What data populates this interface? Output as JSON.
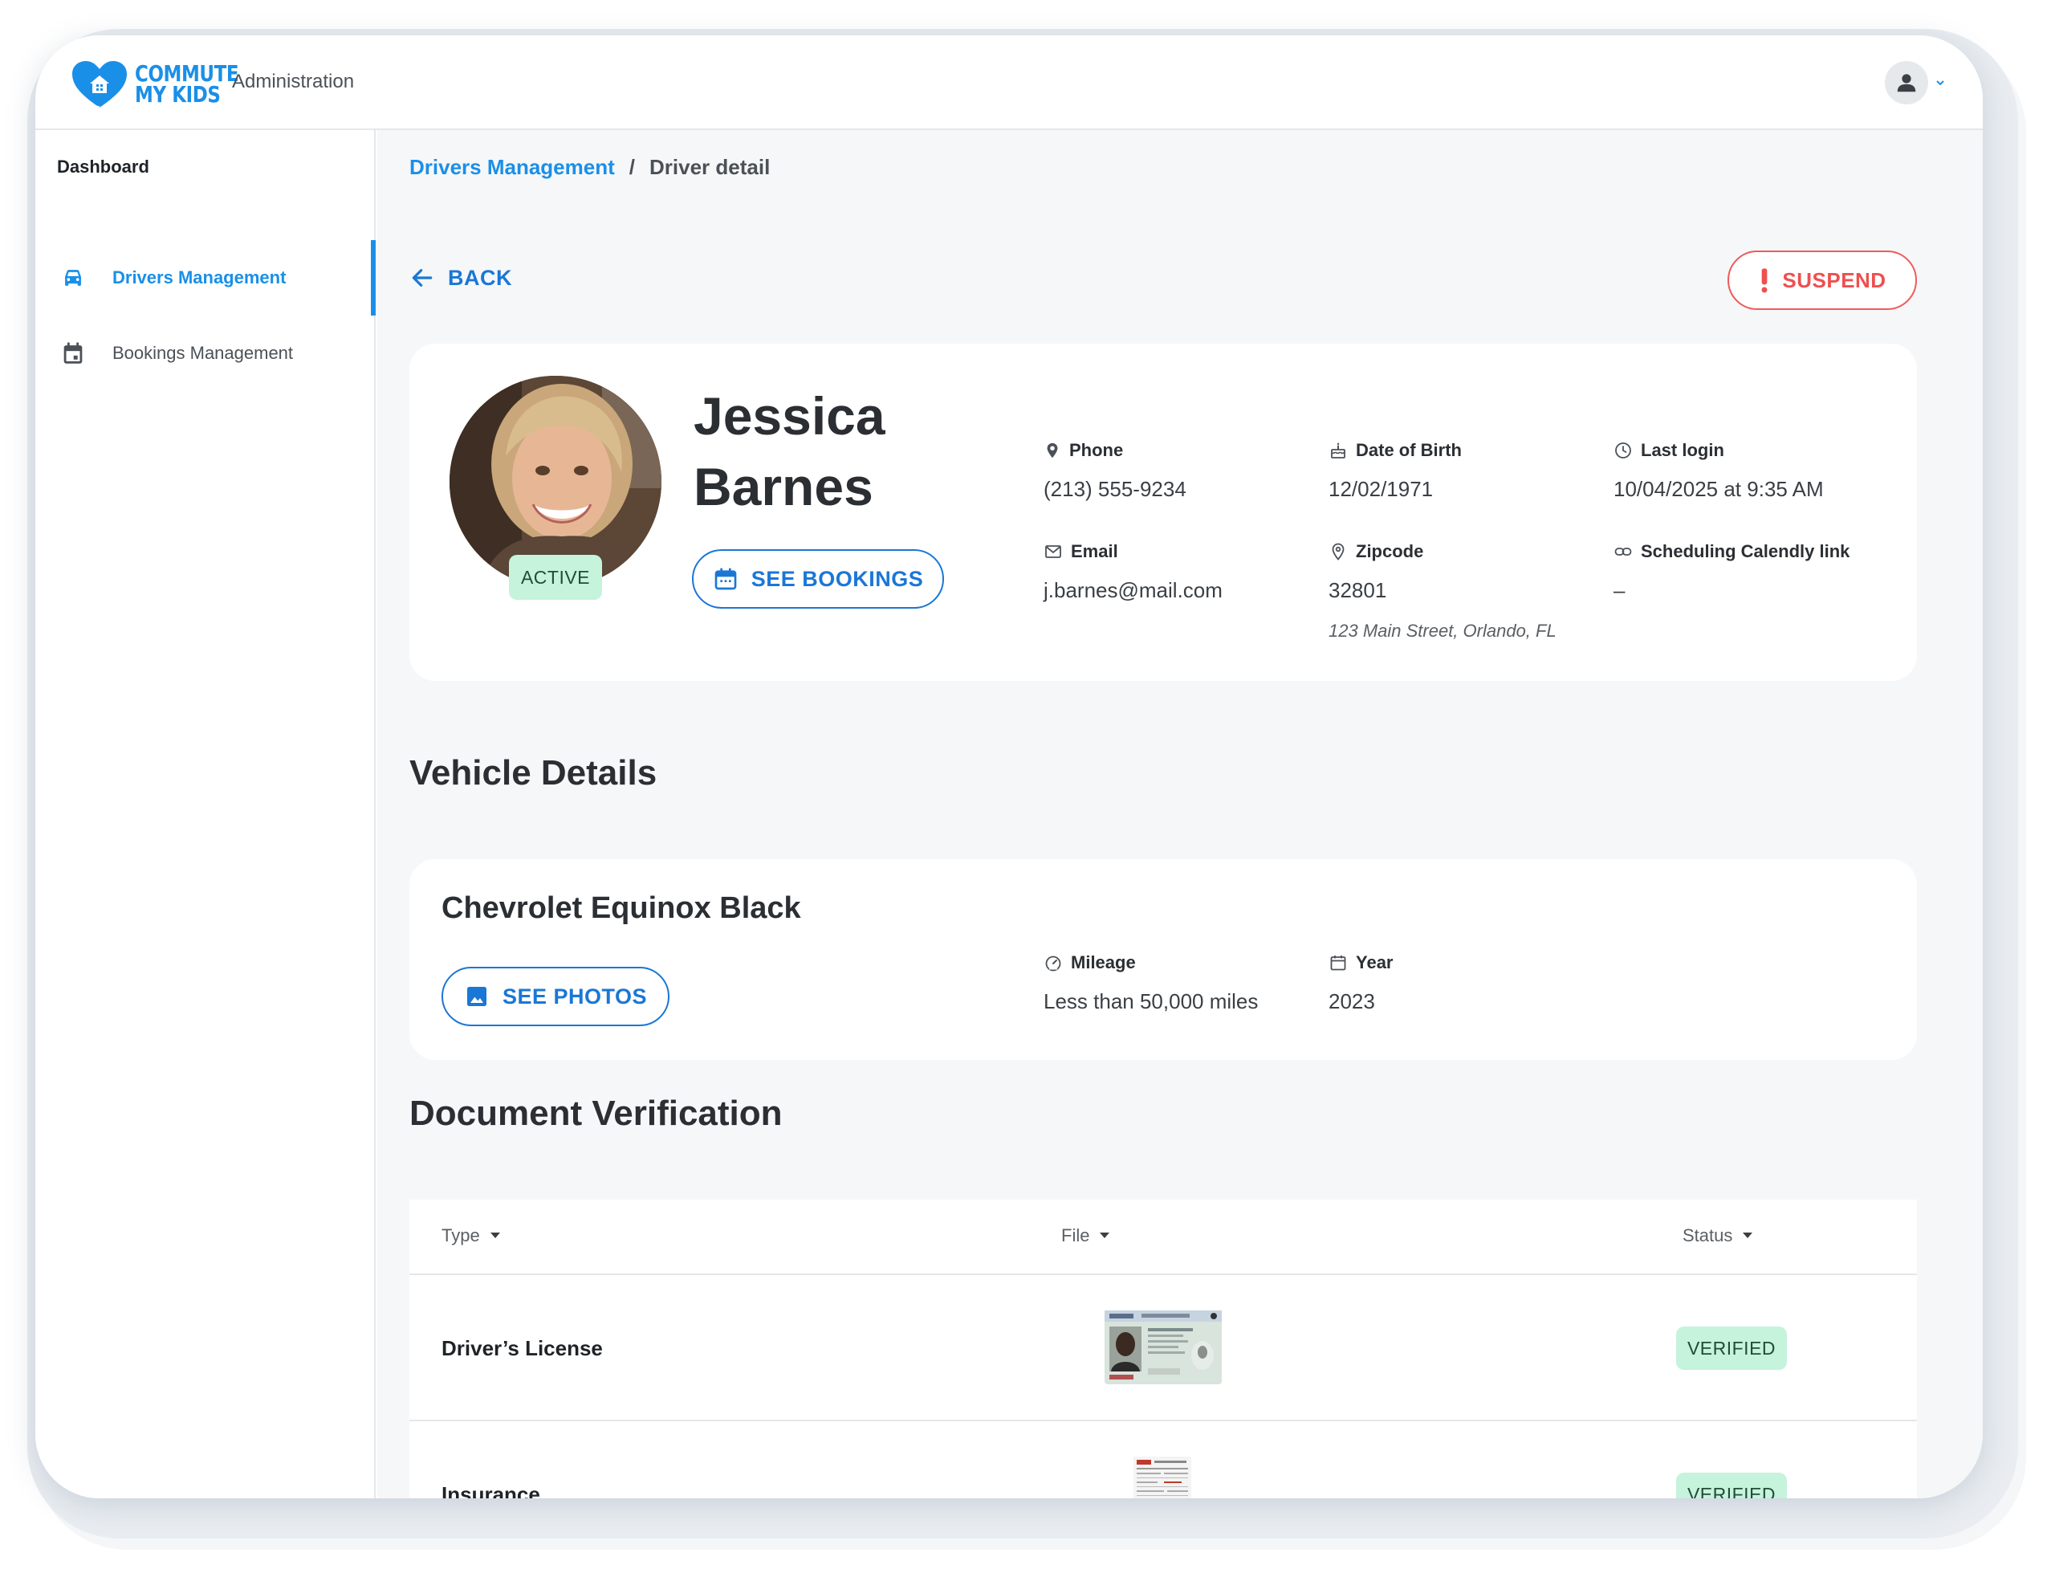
{
  "app": {
    "logo_line1": "COMMUTE",
    "logo_line2": "MY KIDS",
    "header_title": "Administration",
    "brand_color": "#1a8fe8"
  },
  "sidebar": {
    "title": "Dashboard",
    "items": [
      {
        "label": "Drivers Management",
        "icon": "car-icon",
        "active": true
      },
      {
        "label": "Bookings Management",
        "icon": "calendar-icon",
        "active": false
      }
    ]
  },
  "breadcrumb": {
    "parent": "Drivers Management",
    "separator": "/",
    "current": "Driver detail"
  },
  "actions": {
    "back_label": "BACK",
    "suspend_label": "SUSPEND"
  },
  "driver": {
    "first_name": "Jessica",
    "last_name": "Barnes",
    "status": "ACTIVE",
    "see_bookings_label": "SEE BOOKINGS",
    "fields": {
      "phone": {
        "label": "Phone",
        "value": "(213) 555-9234",
        "icon": "phone-pin-icon"
      },
      "dob": {
        "label": "Date of Birth",
        "value": "12/02/1971",
        "icon": "cake-icon"
      },
      "last_login": {
        "label": "Last login",
        "value": "10/04/2025 at 9:35 AM",
        "icon": "clock-icon"
      },
      "email": {
        "label": "Email",
        "value": "j.barnes@mail.com",
        "icon": "mail-icon"
      },
      "zipcode": {
        "label": "Zipcode",
        "value": "32801",
        "address": "123 Main Street, Orlando, FL",
        "icon": "location-pin-icon"
      },
      "calendly": {
        "label": "Scheduling Calendly link",
        "value": "–",
        "icon": "link-icon"
      }
    }
  },
  "vehicle": {
    "section_title": "Vehicle Details",
    "name": "Chevrolet Equinox Black",
    "see_photos_label": "SEE PHOTOS",
    "mileage": {
      "label": "Mileage",
      "value": "Less than 50,000 miles"
    },
    "year": {
      "label": "Year",
      "value": "2023"
    }
  },
  "documents": {
    "section_title": "Document Verification",
    "columns": [
      "Type",
      "File",
      "Status"
    ],
    "rows": [
      {
        "type": "Driver’s License",
        "file": "drivers-license-thumbnail",
        "status": "VERIFIED"
      },
      {
        "type": "Insurance",
        "file": "insurance-document-thumbnail",
        "status": "VERIFIED"
      }
    ]
  }
}
